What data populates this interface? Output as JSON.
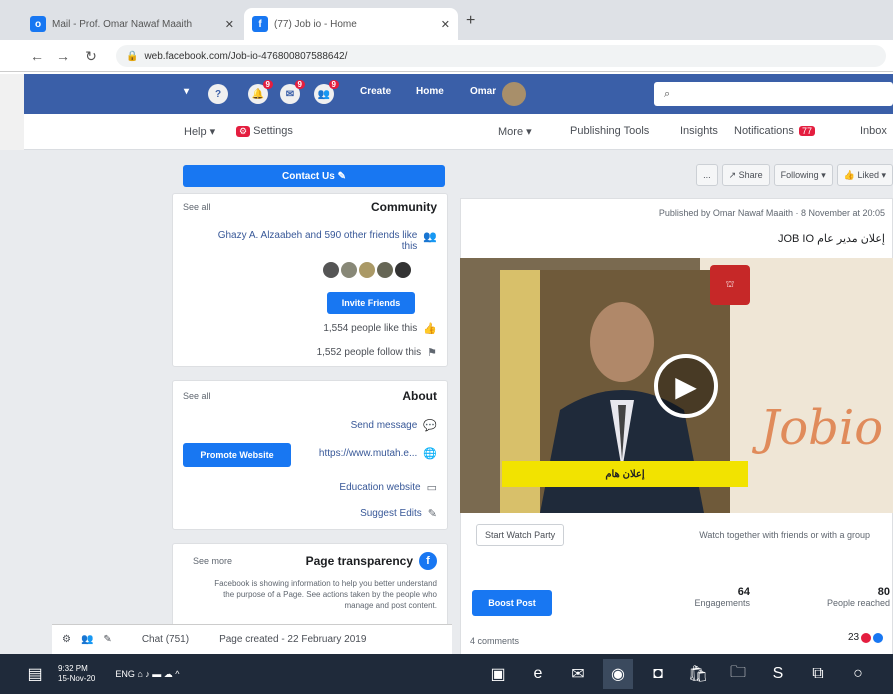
{
  "browser": {
    "tabs": [
      {
        "title": "Mail - Prof. Omar Nawaf Maaith",
        "icon": "outlook-icon"
      },
      {
        "title": "(77) Job io - Home",
        "icon": "facebook-icon"
      }
    ],
    "url": "web.facebook.com/Job-io-476800807588642/"
  },
  "fb_header": {
    "search_placeholder": "",
    "nav": [
      "Omar",
      "Home",
      "Create"
    ],
    "badges": [
      "9",
      "9",
      "9"
    ]
  },
  "page_nav": {
    "items": [
      "Help",
      "Settings",
      "More",
      "Publishing Tools",
      "Insights",
      "Notifications",
      "Inbox"
    ],
    "settings_badge": "",
    "notifications_badge": "77"
  },
  "sidebar": {
    "contact_button": "Contact Us",
    "community": {
      "title": "Community",
      "see_all": "See all",
      "friends_text": "Ghazy A. Alzaabeh and 590 other friends like this",
      "invite_button": "Invite Friends",
      "likes": "1,554 people like this",
      "follows": "1,552 people follow this"
    },
    "about": {
      "title": "About",
      "see_all": "See all",
      "send_message": "Send message",
      "website": "https://www.mutah.e...",
      "promote_button": "Promote Website",
      "category": "Education website",
      "suggest": "Suggest Edits"
    },
    "transparency": {
      "title": "Page transparency",
      "see_more": "See more",
      "body": "Facebook is showing information to help you better understand the purpose of a Page. See actions taken by the people who manage and post content.",
      "created": "Page created - 22 February 2019"
    }
  },
  "chat": {
    "label": "Chat (751)"
  },
  "feed": {
    "actions": [
      "Liked",
      "Following",
      "Share",
      "..."
    ],
    "post_meta": "Published by Omar Nawaf Maaith · 8 November at 20:05",
    "post_text": "JOB IO إعلان مدير عام",
    "caption": "إعلان هام",
    "watch_party": "Start Watch Party",
    "watch_hint": "Watch together with friends or with a group",
    "stats": [
      {
        "value": "80",
        "label": "People reached"
      },
      {
        "value": "64",
        "label": "Engagements"
      }
    ],
    "boost_button": "Boost Post",
    "comments": "4 comments",
    "reactions_count": "23"
  },
  "taskbar": {
    "time": "9:32 PM",
    "date": "15-Nov-20"
  }
}
